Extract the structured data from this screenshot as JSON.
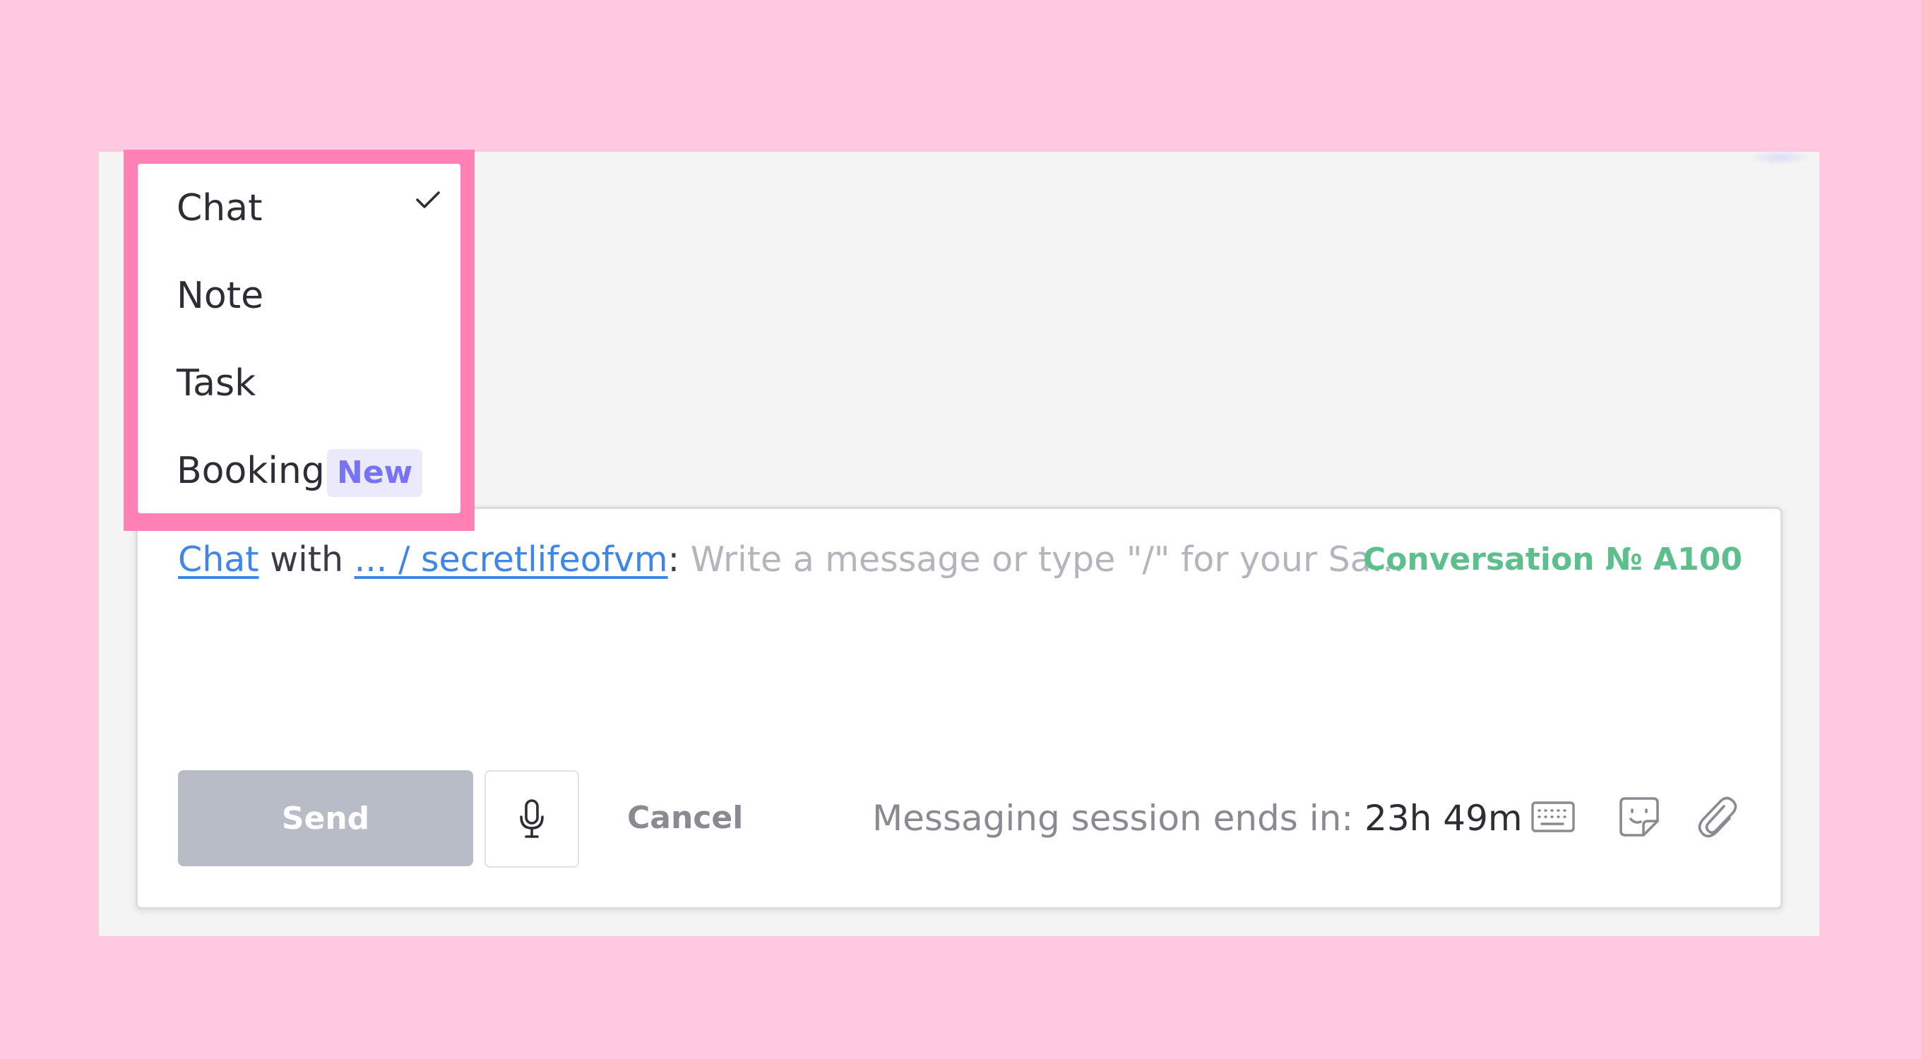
{
  "dropdown": {
    "items": [
      {
        "label": "Chat",
        "selected": true
      },
      {
        "label": "Note"
      },
      {
        "label": "Task"
      },
      {
        "label": "Booking",
        "badge": "New"
      }
    ]
  },
  "composer": {
    "mode_link": "Chat",
    "with_text": "with",
    "contact_link": "... / secretlifeofvm",
    "colon": ":",
    "placeholder": "Write a message or type \"/\" for your Sa...",
    "conversation_label": "Conversation № A100",
    "send_label": "Send",
    "cancel_label": "Cancel",
    "session_label": "Messaging session ends in:",
    "session_time": "23h 49m"
  },
  "icons": {
    "mic": "microphone-icon",
    "keyboard": "keyboard-icon",
    "sticker": "sticker-icon",
    "attach": "paperclip-icon",
    "check": "checkmark-icon"
  },
  "colors": {
    "background": "#ffcae1",
    "highlight": "#ff80b5",
    "link": "#3e86e8",
    "conversation": "#5cbf8c",
    "badge_text": "#7773f2",
    "send_disabled": "#b7bcc6"
  }
}
